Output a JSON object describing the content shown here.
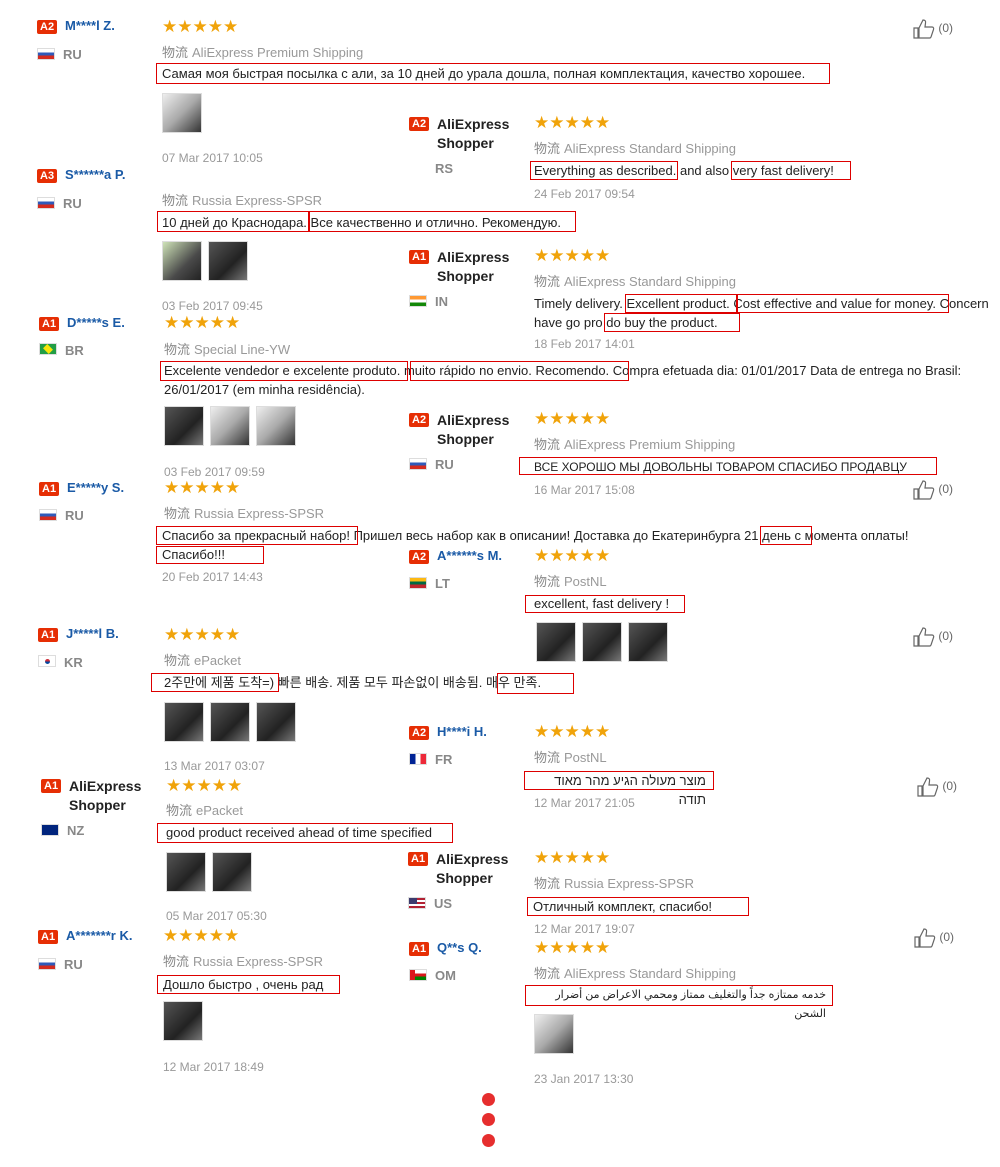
{
  "ship_prefix": "物流",
  "like_count": "(0)",
  "reviews": [
    {
      "level": "A2",
      "name": "M****l Z.",
      "country": "RU",
      "shipping": "AliExpress Premium Shipping",
      "text": "Самая моя быстрая посылка с али, за 10 дней до урала дошла, полная комплектация, качество хорошее.",
      "date": "07 Mar 2017 10:05"
    },
    {
      "level": "A3",
      "name": "S******a P.",
      "country": "RU",
      "shipping": "Russia Express-SPSR",
      "text": "10 дней до Краснодара. Все качественно и отлично. Рекомендую.",
      "date": "03 Feb 2017 09:45"
    },
    {
      "level": "A1",
      "name": "D*****s E.",
      "country": "BR",
      "shipping": "Special Line-YW",
      "text": "Excelente vendedor e excelente produto. muito rápido no envio. Recomendo. Compra efetuada dia: 01/01/2017 Data de entrega no Brasil: 26/01/2017 (em minha residência).",
      "date": "03 Feb 2017 09:59"
    },
    {
      "level": "A1",
      "name": "E*****y S.",
      "country": "RU",
      "shipping": "Russia Express-SPSR",
      "text": "Спасибо за прекрасный набор! Пришел весь набор как в описании! Доставка до Екатеринбурга 21 день с момента оплаты! Спасибо!!!",
      "date": "20 Feb 2017 14:43"
    },
    {
      "level": "A1",
      "name": "J*****l B.",
      "country": "KR",
      "shipping": "ePacket",
      "text": "2주만에 제품 도착=) 빠른 배송. 제품 모두 파손없이 배송됨. 매우 만족.",
      "date": "13 Mar 2017 03:07"
    },
    {
      "level": "A1",
      "name": "AliExpress Shopper",
      "country": "NZ",
      "shipping": "ePacket",
      "text": "good product received ahead of time specified",
      "date": "05 Mar 2017 05:30"
    },
    {
      "level": "A1",
      "name": "A*******r K.",
      "country": "RU",
      "shipping": "Russia Express-SPSR",
      "text": "Дошло быстро , очень рад",
      "date": "12 Mar 2017 18:49"
    },
    {
      "level": "A2",
      "name": "AliExpress Shopper",
      "country": "RS",
      "shipping": "AliExpress Standard Shipping",
      "text": "Everything as described. and also very fast delivery!",
      "date": "24 Feb 2017 09:54"
    },
    {
      "level": "A1",
      "name": "AliExpress Shopper",
      "country": "IN",
      "shipping": "AliExpress Standard Shipping",
      "text": "Timely delivery. Excellent product. Cost effective and value for money. Concern have go pro do buy the product.",
      "date": "18 Feb 2017 14:01"
    },
    {
      "level": "A2",
      "name": "AliExpress Shopper",
      "country": "RU",
      "shipping": "AliExpress Premium Shipping",
      "text": "ВСЕ ХОРОШО МЫ ДОВОЛЬНЫ ТОВАРОМ СПАСИБО ПРОДАВЦУ",
      "date": "16 Mar 2017 15:08"
    },
    {
      "level": "A2",
      "name": "A******s M.",
      "country": "LT",
      "shipping": "PostNL",
      "text": "excellent, fast delivery !",
      "date": ""
    },
    {
      "level": "A2",
      "name": "H****i H.",
      "country": "FR",
      "shipping": "PostNL",
      "text": "מוצר מעולה הגיע מהר מאוד תודה",
      "date": "12 Mar 2017 21:05"
    },
    {
      "level": "A1",
      "name": "AliExpress Shopper",
      "country": "US",
      "shipping": "Russia Express-SPSR",
      "text": "Отличный комплект, спасибо!",
      "date": "12 Mar 2017 19:07"
    },
    {
      "level": "A1",
      "name": "Q**s Q.",
      "country": "OM",
      "shipping": "AliExpress Standard Shipping",
      "text": "خدمه ممتازه جداً والتغليف ممتاز ومحمي الاعراض من أضرار الشحن",
      "date": "23 Jan 2017 13:30"
    }
  ]
}
